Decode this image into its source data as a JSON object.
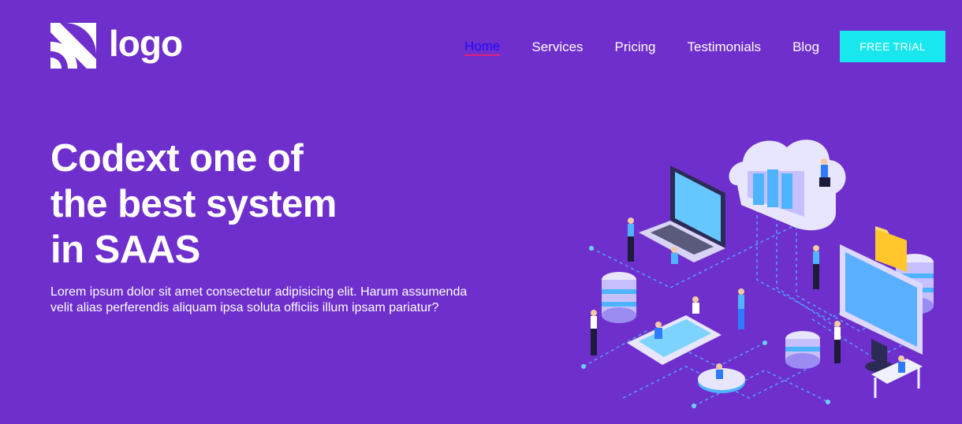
{
  "brand": {
    "logo_text": "logo"
  },
  "nav": {
    "items": [
      {
        "label": "Home",
        "active": true
      },
      {
        "label": "Services",
        "active": false
      },
      {
        "label": "Pricing",
        "active": false
      },
      {
        "label": "Testimonials",
        "active": false
      },
      {
        "label": "Blog",
        "active": false
      }
    ],
    "cta_label": "FREE TRIAL"
  },
  "hero": {
    "title_lines": [
      "Codext one of",
      "the best system",
      "in SAAS"
    ],
    "description": "Lorem ipsum dolor sit amet consectetur adipisicing elit. Harum assumenda velit alias perferendis aliquam ipsa soluta officiis illum ipsam pariatur?"
  },
  "colors": {
    "background": "#6e2fcd",
    "cta": "#18e8ee",
    "active_link": "#1f0bff",
    "active_underline": "#e0207b"
  }
}
